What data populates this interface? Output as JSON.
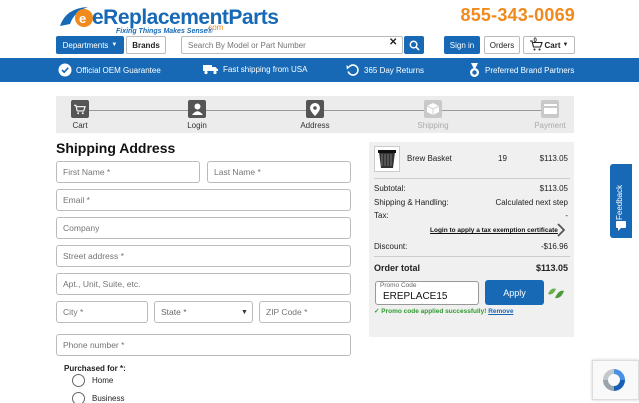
{
  "brand": {
    "name": "eReplacementParts",
    "com": ".com",
    "tagline": "Fixing Things Makes Sense®",
    "phone": "855-343-0069"
  },
  "nav": {
    "departments_label": "Departments",
    "brands_label": "Brands",
    "search_placeholder": "Search By Model or Part Number",
    "signin_label": "Sign in",
    "orders_label": "Orders",
    "cart_label": "Cart",
    "cart_count": "0"
  },
  "benefits": [
    {
      "icon": "badge-check-icon",
      "label": "Official OEM Guarantee"
    },
    {
      "icon": "truck-icon",
      "label": "Fast shipping from USA"
    },
    {
      "icon": "return-icon",
      "label": "365 Day Returns"
    },
    {
      "icon": "medal-icon",
      "label": "Preferred Brand Partners"
    }
  ],
  "steps": [
    {
      "label": "Cart",
      "state": "done"
    },
    {
      "label": "Login",
      "state": "done"
    },
    {
      "label": "Address",
      "state": "done"
    },
    {
      "label": "Shipping",
      "state": "todo"
    },
    {
      "label": "Payment",
      "state": "todo"
    }
  ],
  "form": {
    "title": "Shipping Address",
    "first_name": "First Name *",
    "last_name": "Last Name *",
    "email": "Email *",
    "company": "Company",
    "street": "Street address *",
    "apt": "Apt., Unit, Suite, etc.",
    "city": "City *",
    "state": "State *",
    "zip": "ZIP Code *",
    "phone": "Phone number *",
    "purchased_for": "Purchased for *:",
    "options": [
      "Home",
      "Business"
    ]
  },
  "summary": {
    "product_name": "Brew Basket",
    "product_qty": "19",
    "product_price": "$113.05",
    "subtotal_label": "Subtotal:",
    "subtotal_value": "$113.05",
    "shipping_label": "Shipping & Handling:",
    "shipping_value": "Calculated next step",
    "tax_label": "Tax:",
    "tax_value": "-",
    "tax_link": "Login to apply a tax exemption certificate",
    "discount_label": "Discount:",
    "discount_value": "-$16.96",
    "total_label": "Order total",
    "total_value": "$113.05",
    "promo_label": "Promo Code",
    "promo_value": "EREPLACE15",
    "apply_label": "Apply",
    "promo_success": "✓ Promo code applied successfully!",
    "promo_remove": "Remove"
  },
  "widgets": {
    "feedback_label": "Feedback"
  },
  "colors": {
    "brand_blue": "#1769b6",
    "brand_orange": "#f08a1c",
    "success_green": "#2e9a2e"
  }
}
